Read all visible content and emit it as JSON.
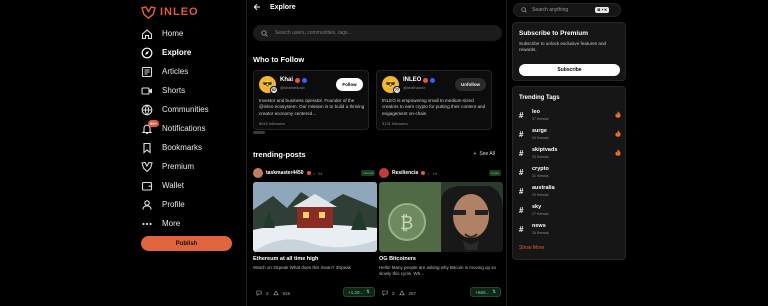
{
  "brand": {
    "name": "INLEO",
    "accent": "#e35a37"
  },
  "nav": [
    {
      "label": "Home",
      "icon": "home-icon",
      "active": false
    },
    {
      "label": "Explore",
      "icon": "compass-icon",
      "active": true
    },
    {
      "label": "Articles",
      "icon": "articles-icon",
      "active": false
    },
    {
      "label": "Shorts",
      "icon": "video-icon",
      "active": false
    },
    {
      "label": "Communities",
      "icon": "globe-icon",
      "active": false
    },
    {
      "label": "Notifications",
      "icon": "bell-icon",
      "active": false,
      "badge": "99+"
    },
    {
      "label": "Bookmarks",
      "icon": "bookmark-icon",
      "active": false
    },
    {
      "label": "Premium",
      "icon": "leo-icon",
      "active": false
    },
    {
      "label": "Wallet",
      "icon": "wallet-icon",
      "active": false
    },
    {
      "label": "Profile",
      "icon": "user-icon",
      "active": false
    },
    {
      "label": "More",
      "icon": "dots-icon",
      "active": false
    }
  ],
  "publish_label": "Publish",
  "main": {
    "title": "Explore",
    "search_placeholder": "Search users, communities, tags...",
    "who_to_follow": {
      "title": "Who to Follow",
      "cards": [
        {
          "name": "Khai",
          "handle": "@khaiwelkazi",
          "level": "62",
          "button": "Follow",
          "bio": "Investor and business operator. Founder of the @inleo ecosystem. Our mission is to build a thriving creator economy centered...",
          "followers": "8816 followers"
        },
        {
          "name": "INLEO",
          "handle": "@leofinance",
          "level": "77",
          "button": "Unfollow",
          "bio": "INLEO is empowering small to medium-sized creators to earn crypto for putting their content and engagement on-chain",
          "followers": "3131 followers"
        }
      ]
    },
    "trending": {
      "title": "trending-posts",
      "see_all": "See All",
      "posts": [
        {
          "author": "taskmaster4450",
          "level": "24",
          "tag": "cinema",
          "title": "Ethereum at all time high",
          "desc": "Watch on 3Speak What does this mean? 3Speak",
          "comments": "2",
          "votes": "915",
          "payout": "+1.20..."
        },
        {
          "author": "Resiliencia",
          "level": "10",
          "tag": "crypto",
          "title": "OG Bitcoiners",
          "desc": "Hello! Many people are asking why Bitcoin is moving up so slowly this cycle. Wh...",
          "comments": "3",
          "votes": "257",
          "payout": "+660..."
        }
      ]
    }
  },
  "right": {
    "search_placeholder": "Search anything",
    "search_kbd": "⌘ + K",
    "premium": {
      "title": "Subscribe to Premium",
      "desc": "Subscribe to unlock exclusive features and rewards.",
      "button": "Subscribe"
    },
    "trending_tags": {
      "title": "Trending Tags",
      "show_more": "Show More",
      "tags": [
        {
          "name": "leo",
          "count": "37 threads",
          "hot": true
        },
        {
          "name": "surge",
          "count": "34 threads",
          "hot": true
        },
        {
          "name": "skiptvads",
          "count": "33 threads",
          "hot": true
        },
        {
          "name": "crypto",
          "count": "31 threads",
          "hot": false
        },
        {
          "name": "australia",
          "count": "29 threads",
          "hot": false
        },
        {
          "name": "sky",
          "count": "27 threads",
          "hot": false
        },
        {
          "name": "news",
          "count": "26 threads",
          "hot": false
        }
      ]
    }
  }
}
